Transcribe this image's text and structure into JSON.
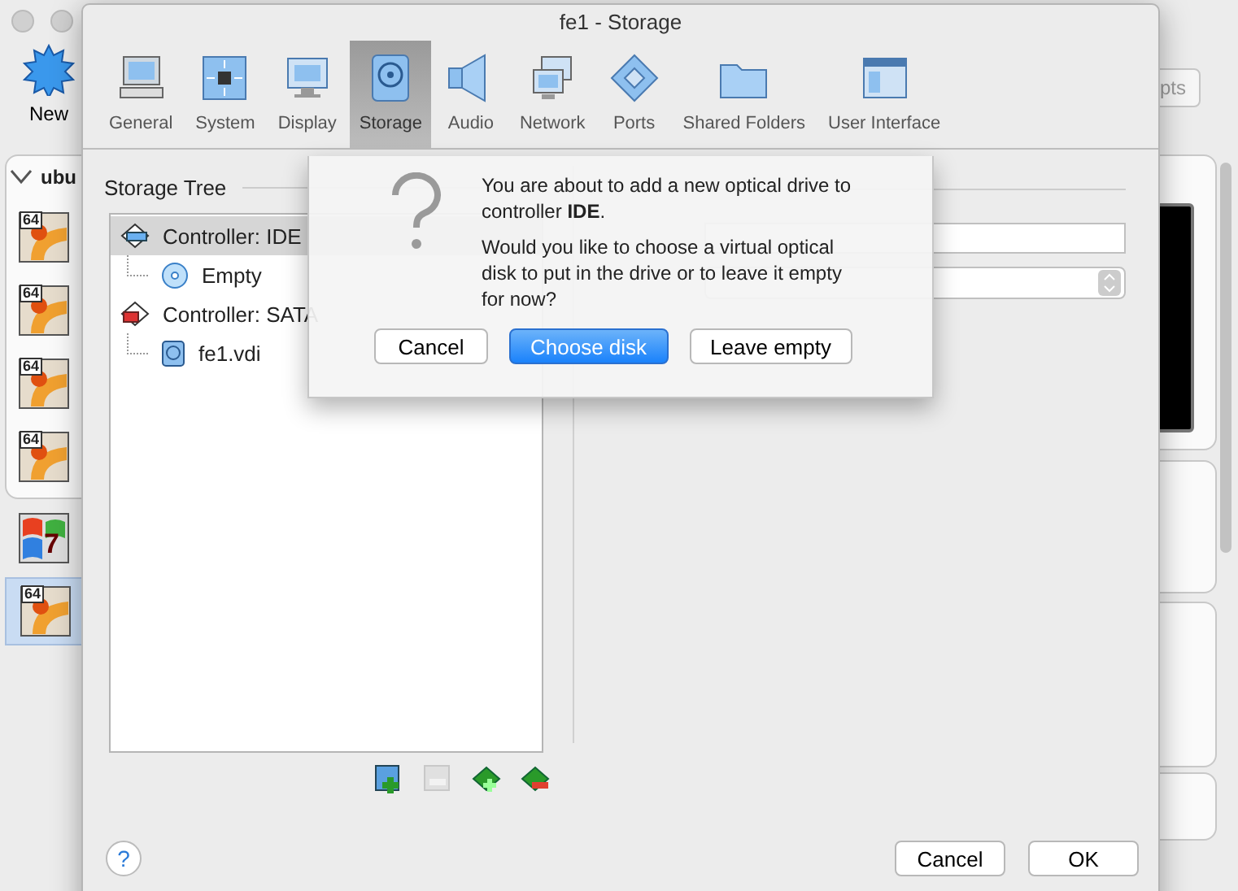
{
  "main_window": {
    "toolbar": [
      {
        "label": "New"
      }
    ],
    "right_button": {
      "label": "pts"
    },
    "group": {
      "label": "ubu",
      "expanded": true,
      "vms": [
        {
          "kind": "ubuntu",
          "badge": "64",
          "selected": false
        },
        {
          "kind": "ubuntu",
          "badge": "64",
          "selected": false
        },
        {
          "kind": "ubuntu",
          "badge": "64",
          "selected": false
        },
        {
          "kind": "ubuntu",
          "badge": "64",
          "selected": false
        }
      ]
    },
    "vms": [
      {
        "kind": "windows",
        "badge": "7",
        "selected": false
      },
      {
        "kind": "ubuntu",
        "badge": "64",
        "selected": true
      }
    ]
  },
  "dialog": {
    "title": "fe1 - Storage",
    "tabs": [
      {
        "label": "General",
        "selected": false
      },
      {
        "label": "System",
        "selected": false
      },
      {
        "label": "Display",
        "selected": false
      },
      {
        "label": "Storage",
        "selected": true
      },
      {
        "label": "Audio",
        "selected": false
      },
      {
        "label": "Network",
        "selected": false
      },
      {
        "label": "Ports",
        "selected": false
      },
      {
        "label": "Shared Folders",
        "selected": false
      },
      {
        "label": "User Interface",
        "selected": false
      }
    ],
    "storage_tree": {
      "title": "Storage Tree",
      "items": [
        {
          "kind": "ide",
          "label": "Controller: IDE",
          "selected": true,
          "children": [
            {
              "kind": "optical",
              "label": "Empty",
              "selected": false
            }
          ]
        },
        {
          "kind": "sata",
          "label": "Controller: SATA",
          "selected": false,
          "children": [
            {
              "kind": "disk",
              "label": "fe1.vdi",
              "selected": false
            }
          ]
        }
      ],
      "actions": [
        {
          "kind": "add-attachment",
          "disabled": false
        },
        {
          "kind": "remove-attachment",
          "disabled": true
        },
        {
          "kind": "add-controller",
          "disabled": false
        },
        {
          "kind": "remove-controller",
          "disabled": false
        }
      ]
    },
    "help": {
      "label": "?"
    },
    "buttons": [
      {
        "label": "Cancel",
        "default": false
      },
      {
        "label": "OK",
        "default": false
      }
    ]
  },
  "alert": {
    "message": "You are about to add a new optical drive to controller **IDE**.",
    "question": "Would you like to choose a virtual optical disk to put in the drive or to leave it empty for now?",
    "buttons": [
      {
        "label": "Cancel",
        "default": false
      },
      {
        "label": "Choose disk",
        "default": true
      },
      {
        "label": "Leave empty",
        "default": false
      }
    ]
  }
}
